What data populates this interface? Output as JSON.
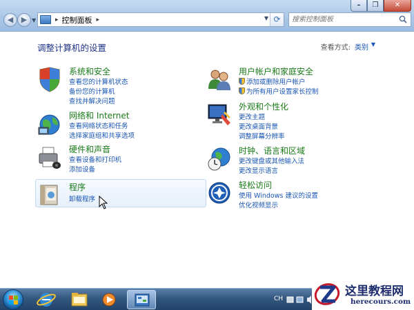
{
  "window": {
    "controls": [
      "minimize",
      "maximize",
      "close"
    ]
  },
  "address_bar": {
    "path": "控制面板",
    "separator": "▸"
  },
  "search": {
    "placeholder": "搜索控制面板"
  },
  "content": {
    "title": "调整计算机的设置",
    "view_by_label": "查看方式:",
    "view_by_value": "类别"
  },
  "categories": [
    {
      "title": "系统和安全",
      "icon": "shield-icon",
      "links": [
        "查看您的计算机状态",
        "备份您的计算机",
        "查找并解决问题"
      ]
    },
    {
      "title": "网络和 Internet",
      "icon": "network-globe-icon",
      "links": [
        "查看网络状态和任务",
        "选择家庭组和共享选项"
      ]
    },
    {
      "title": "硬件和声音",
      "icon": "printer-icon",
      "links": [
        "查看设备和打印机",
        "添加设备"
      ]
    },
    {
      "title": "程序",
      "icon": "programs-icon",
      "links": [
        "卸载程序"
      ]
    },
    {
      "title": "用户帐户和家庭安全",
      "icon": "users-icon",
      "links": [
        "添加或删除用户帐户",
        "为所有用户设置家长控制"
      ]
    },
    {
      "title": "外观和个性化",
      "icon": "monitor-palette-icon",
      "links": [
        "更改主题",
        "更改桌面背景",
        "调整屏幕分辨率"
      ]
    },
    {
      "title": "时钟、语言和区域",
      "icon": "clock-globe-icon",
      "links": [
        "更改键盘或其他输入法",
        "更改显示语言"
      ]
    },
    {
      "title": "轻松访问",
      "icon": "ease-of-access-icon",
      "links": [
        "使用 Windows 建议的设置",
        "优化视频显示"
      ]
    }
  ],
  "taskbar": {
    "items": [
      "start-orb",
      "internet-explorer-icon",
      "file-explorer-icon",
      "media-player-icon",
      "control-panel-icon"
    ],
    "tray_language": "CH"
  },
  "watermark": {
    "text_cn": "这里教程网",
    "text_en": "herecours.com"
  },
  "colors": {
    "category_title": "#1a7a1a",
    "link": "#1a56b4",
    "page_title": "#1e3287",
    "titlebar": "#a9c6e6",
    "taskbar": "#34577f"
  }
}
